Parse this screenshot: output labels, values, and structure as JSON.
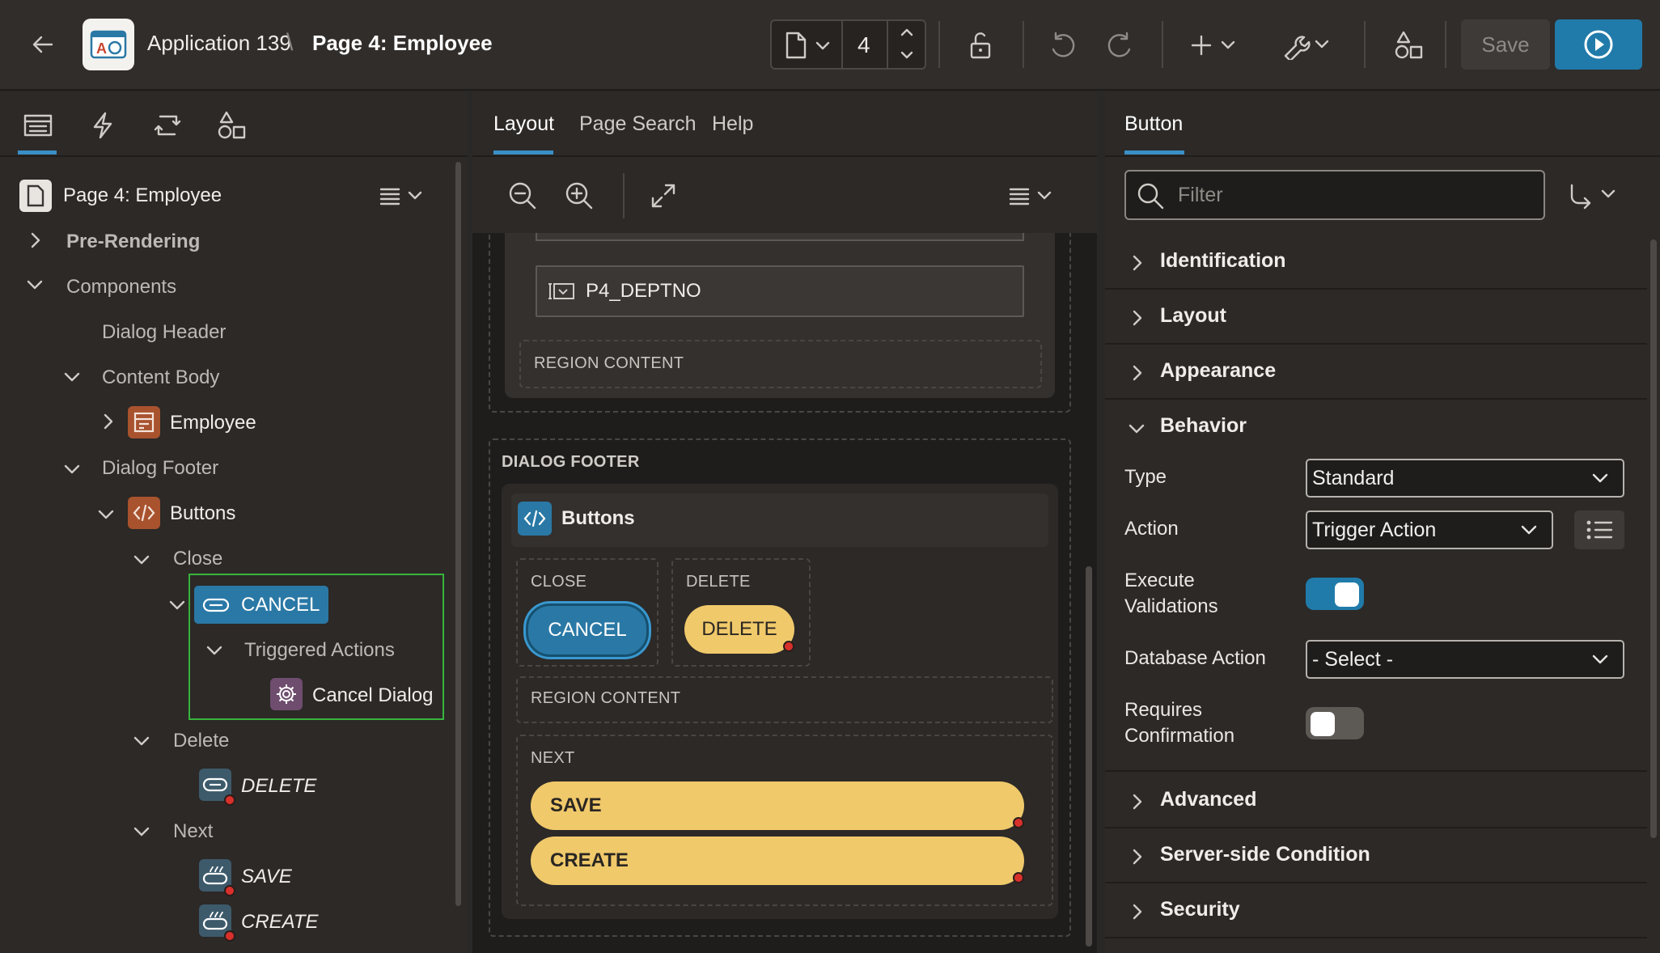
{
  "header": {
    "app_name": "Application 139",
    "separator": "\\",
    "page_title": "Page 4: Employee",
    "page_number": "4",
    "save_label": "Save",
    "icons": [
      "back-arrow-icon",
      "app-logo-icon",
      "page-icon",
      "chevron-up-icon",
      "chevron-down-icon",
      "unlock-icon",
      "undo-icon",
      "redo-icon",
      "plus-icon",
      "wrench-icon",
      "shared-components-icon",
      "run-icon"
    ]
  },
  "left": {
    "tabs": [
      "rendering-tab",
      "dynamic-actions-tab",
      "processing-tab",
      "shared-components-tab"
    ],
    "root_label": "Page 4: Employee",
    "tree": {
      "pre_rendering": "Pre-Rendering",
      "components": "Components",
      "dialog_header": "Dialog Header",
      "content_body": "Content Body",
      "employee": "Employee",
      "dialog_footer": "Dialog Footer",
      "buttons": "Buttons",
      "close": "Close",
      "cancel": "CANCEL",
      "triggered_actions": "Triggered Actions",
      "cancel_dialog": "Cancel Dialog",
      "delete_group": "Delete",
      "delete_btn": "DELETE",
      "next_group": "Next",
      "save_btn": "SAVE",
      "create_btn": "CREATE"
    }
  },
  "middle": {
    "tabs": {
      "layout": "Layout",
      "page_search": "Page Search",
      "help": "Help"
    },
    "canvas": {
      "item_deptno": "P4_DEPTNO",
      "region_content_1": "REGION CONTENT",
      "dialog_footer": "DIALOG FOOTER",
      "buttons_region": "Buttons",
      "close_slot": "CLOSE",
      "delete_slot": "DELETE",
      "cancel_btn": "CANCEL",
      "delete_btn": "DELETE",
      "region_content_2": "REGION CONTENT",
      "next_slot": "NEXT",
      "save_btn": "SAVE",
      "create_btn": "CREATE"
    }
  },
  "right": {
    "tab": "Button",
    "filter_placeholder": "Filter",
    "sections": {
      "identification": "Identification",
      "layout": "Layout",
      "appearance": "Appearance",
      "behavior": "Behavior",
      "advanced": "Advanced",
      "server_side_condition": "Server-side Condition",
      "security": "Security"
    },
    "behavior": {
      "type_label": "Type",
      "type_value": "Standard",
      "action_label": "Action",
      "action_value": "Trigger Action",
      "execute_validations_label_1": "Execute",
      "execute_validations_label_2": "Validations",
      "execute_validations_on": true,
      "database_action_label": "Database Action",
      "database_action_value": "- Select -",
      "requires_confirmation_label_1": "Requires",
      "requires_confirmation_label_2": "Confirmation",
      "requires_confirmation_on": false
    }
  },
  "colors": {
    "accent_blue": "#217baa",
    "selection_green": "#37b43c",
    "hot_button_yellow": "#f0c96b",
    "region_brown": "#a8522e",
    "marker_red": "#d8302b"
  }
}
